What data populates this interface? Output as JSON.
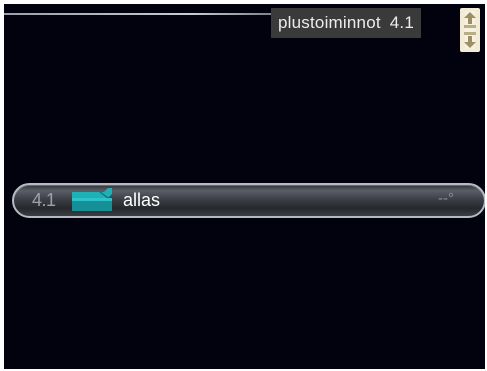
{
  "header": {
    "title": "plustoiminnot",
    "menu_number": "4.1"
  },
  "menu": {
    "items": [
      {
        "number": "4.1",
        "label": "allas",
        "value": "--°",
        "icon": "pool-icon"
      }
    ]
  },
  "scroll_icon": "scroll-arrows-icon",
  "colors": {
    "background": "#01020e",
    "header_box": "#3a3a3a",
    "pool_icon": "#1aa6ad",
    "scroll_icon_bg": "#f2ecd6",
    "scroll_icon_fg": "#9c8f66"
  }
}
